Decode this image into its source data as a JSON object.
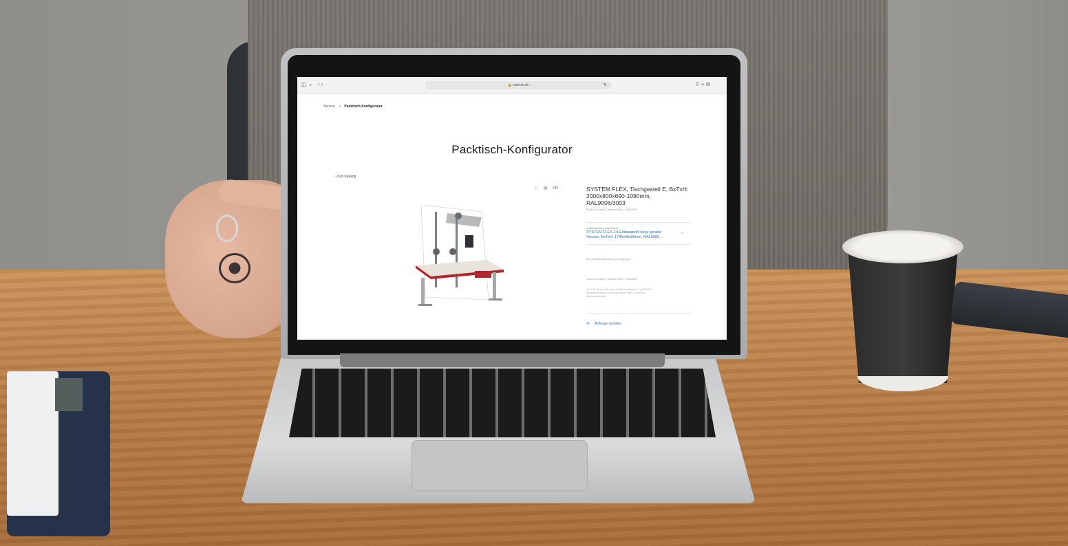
{
  "browser": {
    "url": "🔒 rocholz.de",
    "reload_glyph": "↻",
    "sidebar_glyph": "◫ ⌄",
    "nav_glyph": "‹  ›",
    "actions_glyph": "⇪  +  ⧉"
  },
  "breadcrumb": {
    "parent": "Service",
    "separator": ">",
    "current": "Packtisch-Konfigurator"
  },
  "page": {
    "title": "Packtisch-Konfigurator",
    "back_link": "‹ Zum Katalog"
  },
  "viewer_tools": {
    "fullscreen": "⛶",
    "pdf": "▤",
    "ar": "AR"
  },
  "product": {
    "title": "SYSTEM FLEX, Tischgestell E, BxTxH: 2000x800x690-1090mm, RAL9006/3003",
    "meta": "Rocholz GmbH | System Flex | 70100000",
    "selected_label": "Ausgewählte Komponente",
    "selected_value": "SYSTEM FLEX, Hl-Einbauprofil lang, gerade Version, BxTxH: 1745x40x80mm, RAL9006...",
    "note1": "Die Induktiv-Aufnahme ist verlängert.",
    "note2": "Rocholz GmbH | System Flex | 70100000",
    "note3": "mit 2 Fußtraversen und 2 Systemrahmen, 2-geteilt für geraden Anbau, Höhe über dem Tisch: 1265mm, anthrazitmetallic",
    "cta": "Anfrage senden",
    "cta_icon": "✉"
  },
  "colors": {
    "accent": "#2a6fb3",
    "table_top": "#e8e4dc",
    "frame_red": "#b0282e",
    "frame_grey": "#a7aaad"
  }
}
